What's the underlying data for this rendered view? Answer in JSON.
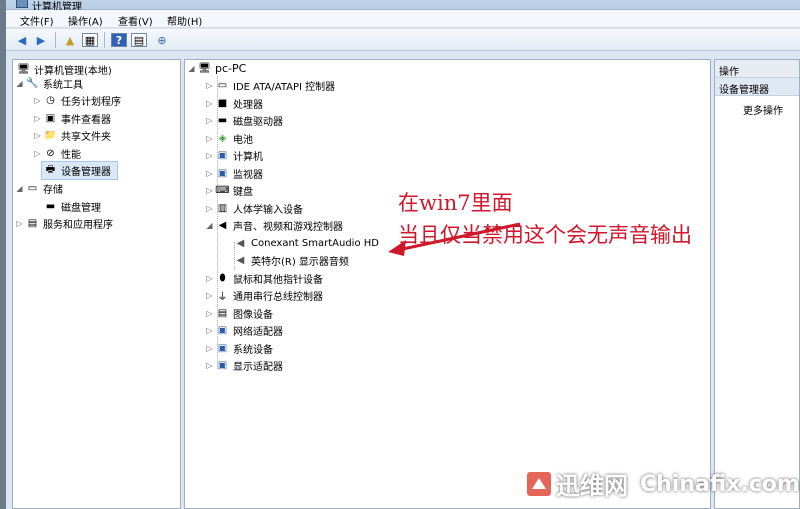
{
  "window": {
    "title": "计算机管理"
  },
  "menu": [
    "文件(F)",
    "操作(A)",
    "查看(V)",
    "帮助(H)"
  ],
  "left_tree": {
    "root": "计算机管理(本地)",
    "system_tools": "系统工具",
    "items": [
      "任务计划程序",
      "事件查看器",
      "共享文件夹",
      "性能",
      "设备管理器"
    ],
    "storage": "存储",
    "disk_mgmt": "磁盘管理",
    "services": "服务和应用程序"
  },
  "device_tree": {
    "root": "pc-PC",
    "categories": [
      "IDE ATA/ATAPI 控制器",
      "处理器",
      "磁盘驱动器",
      "电池",
      "计算机",
      "监视器",
      "键盘",
      "人体学输入设备",
      "声音、视频和游戏控制器"
    ],
    "sound_children": [
      "Conexant SmartAudio HD",
      "英特尔(R) 显示器音频"
    ],
    "categories_after": [
      "鼠标和其他指针设备",
      "通用串行总线控制器",
      "图像设备",
      "网络适配器",
      "系统设备",
      "显示适配器"
    ]
  },
  "actions": {
    "header": "操作",
    "section": "设备管理器",
    "more": "更多操作"
  },
  "annotation": {
    "line1": "在win7里面",
    "line2": "当且仅当禁用这个会无声音输出",
    "color": "#d0182c"
  },
  "watermark": {
    "cn": "迅维网",
    "en": "Chinafix.com"
  }
}
